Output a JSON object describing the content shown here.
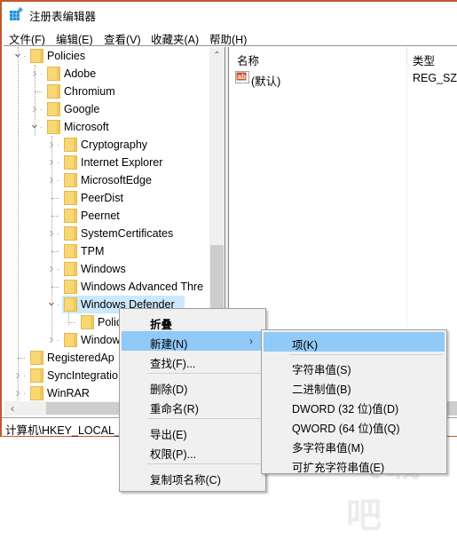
{
  "window": {
    "title": "注册表编辑器",
    "accent_border": "#c4582c"
  },
  "menubar": {
    "items": [
      {
        "label": "文件(F)"
      },
      {
        "label": "编辑(E)"
      },
      {
        "label": "查看(V)"
      },
      {
        "label": "收藏夹(A)"
      },
      {
        "label": "帮助(H)"
      }
    ]
  },
  "tree": {
    "selected": "Windows Defender",
    "nodes": [
      {
        "label": "Policies",
        "level": 1,
        "state": "expanded"
      },
      {
        "label": "Adobe",
        "level": 2,
        "state": "collapsed"
      },
      {
        "label": "Chromium",
        "level": 2,
        "state": "leaf"
      },
      {
        "label": "Google",
        "level": 2,
        "state": "collapsed"
      },
      {
        "label": "Microsoft",
        "level": 2,
        "state": "expanded"
      },
      {
        "label": "Cryptography",
        "level": 3,
        "state": "collapsed"
      },
      {
        "label": "Internet Explorer",
        "level": 3,
        "state": "collapsed"
      },
      {
        "label": "MicrosoftEdge",
        "level": 3,
        "state": "collapsed"
      },
      {
        "label": "PeerDist",
        "level": 3,
        "state": "leaf"
      },
      {
        "label": "Peernet",
        "level": 3,
        "state": "leaf"
      },
      {
        "label": "SystemCertificates",
        "level": 3,
        "state": "collapsed"
      },
      {
        "label": "TPM",
        "level": 3,
        "state": "leaf"
      },
      {
        "label": "Windows",
        "level": 3,
        "state": "collapsed"
      },
      {
        "label": "Windows Advanced Thre",
        "level": 3,
        "state": "leaf"
      },
      {
        "label": "Windows Defender",
        "level": 3,
        "state": "expanded"
      },
      {
        "label": "Polic",
        "level": 4,
        "state": "leaf"
      },
      {
        "label": "Window",
        "level": 3,
        "state": "collapsed"
      },
      {
        "label": "RegisteredAp",
        "level": 1,
        "state": "leaf"
      },
      {
        "label": "SyncIntegratio",
        "level": 1,
        "state": "collapsed"
      },
      {
        "label": "WinRAR",
        "level": 1,
        "state": "collapsed"
      }
    ]
  },
  "values_pane": {
    "columns": [
      "名称",
      "类型"
    ],
    "rows": [
      {
        "icon": "string-value-icon",
        "name": "(默认)",
        "type": "REG_SZ"
      }
    ]
  },
  "statusbar": {
    "path": "计算机\\HKEY_LOCAL_M"
  },
  "context_menu": {
    "items": [
      {
        "label": "折叠",
        "bold": true
      },
      {
        "label": "新建(N)",
        "submenu": true,
        "highlighted": true
      },
      {
        "label": "查找(F)..."
      },
      {
        "separator": true
      },
      {
        "label": "删除(D)"
      },
      {
        "label": "重命名(R)"
      },
      {
        "separator": true
      },
      {
        "label": "导出(E)"
      },
      {
        "label": "权限(P)..."
      },
      {
        "separator": true
      },
      {
        "label": "复制项名称(C)"
      }
    ],
    "submenu_arrow": "›"
  },
  "submenu": {
    "items": [
      {
        "label": "项(K)",
        "highlighted": true
      },
      {
        "separator": true
      },
      {
        "label": "字符串值(S)"
      },
      {
        "label": "二进制值(B)"
      },
      {
        "label": "DWORD (32 位)值(D)"
      },
      {
        "label": "QWORD (64 位)值(Q)"
      },
      {
        "label": "多字符串值(M)"
      },
      {
        "label": "可扩充字符串值(E)"
      }
    ]
  },
  "colors": {
    "menu_highlight": "#91c9f7",
    "tree_selection": "#cce8ff",
    "folder": "#f8d775"
  }
}
